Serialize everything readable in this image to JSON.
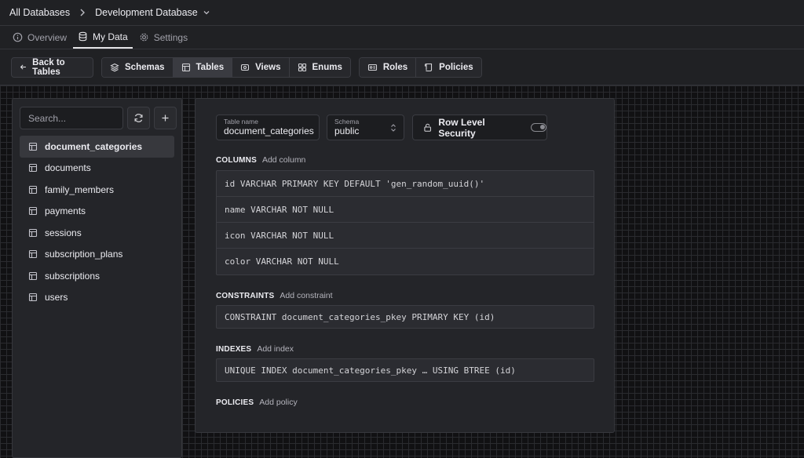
{
  "breadcrumb": {
    "root": "All Databases",
    "database": "Development Database"
  },
  "nav_tabs": [
    "Overview",
    "My Data",
    "Settings"
  ],
  "toolbar": {
    "back_label": "Back to Tables",
    "view_group": [
      "Schemas",
      "Tables",
      "Views",
      "Enums"
    ],
    "access_group": [
      "Roles",
      "Policies"
    ]
  },
  "sidebar": {
    "search_placeholder": "Search...",
    "tables": [
      "document_categories",
      "documents",
      "family_members",
      "payments",
      "sessions",
      "subscription_plans",
      "subscriptions",
      "users"
    ]
  },
  "table_editor": {
    "table_name_label": "Table name",
    "table_name_value": "document_categories",
    "schema_label": "Schema",
    "schema_value": "public",
    "rls_label": "Row Level Security",
    "columns_title": "COLUMNS",
    "columns_add": "Add column",
    "columns": [
      "id VARCHAR PRIMARY KEY DEFAULT 'gen_random_uuid()'",
      "name VARCHAR NOT NULL",
      "icon VARCHAR NOT NULL",
      "color VARCHAR NOT NULL"
    ],
    "constraints_title": "CONSTRAINTS",
    "constraints_add": "Add constraint",
    "constraints": [
      "CONSTRAINT document_categories_pkey PRIMARY KEY (id)"
    ],
    "indexes_title": "INDEXES",
    "indexes_add": "Add index",
    "indexes": [
      "UNIQUE INDEX document_categories_pkey … USING BTREE (id)"
    ],
    "policies_title": "POLICIES",
    "policies_add": "Add policy"
  }
}
